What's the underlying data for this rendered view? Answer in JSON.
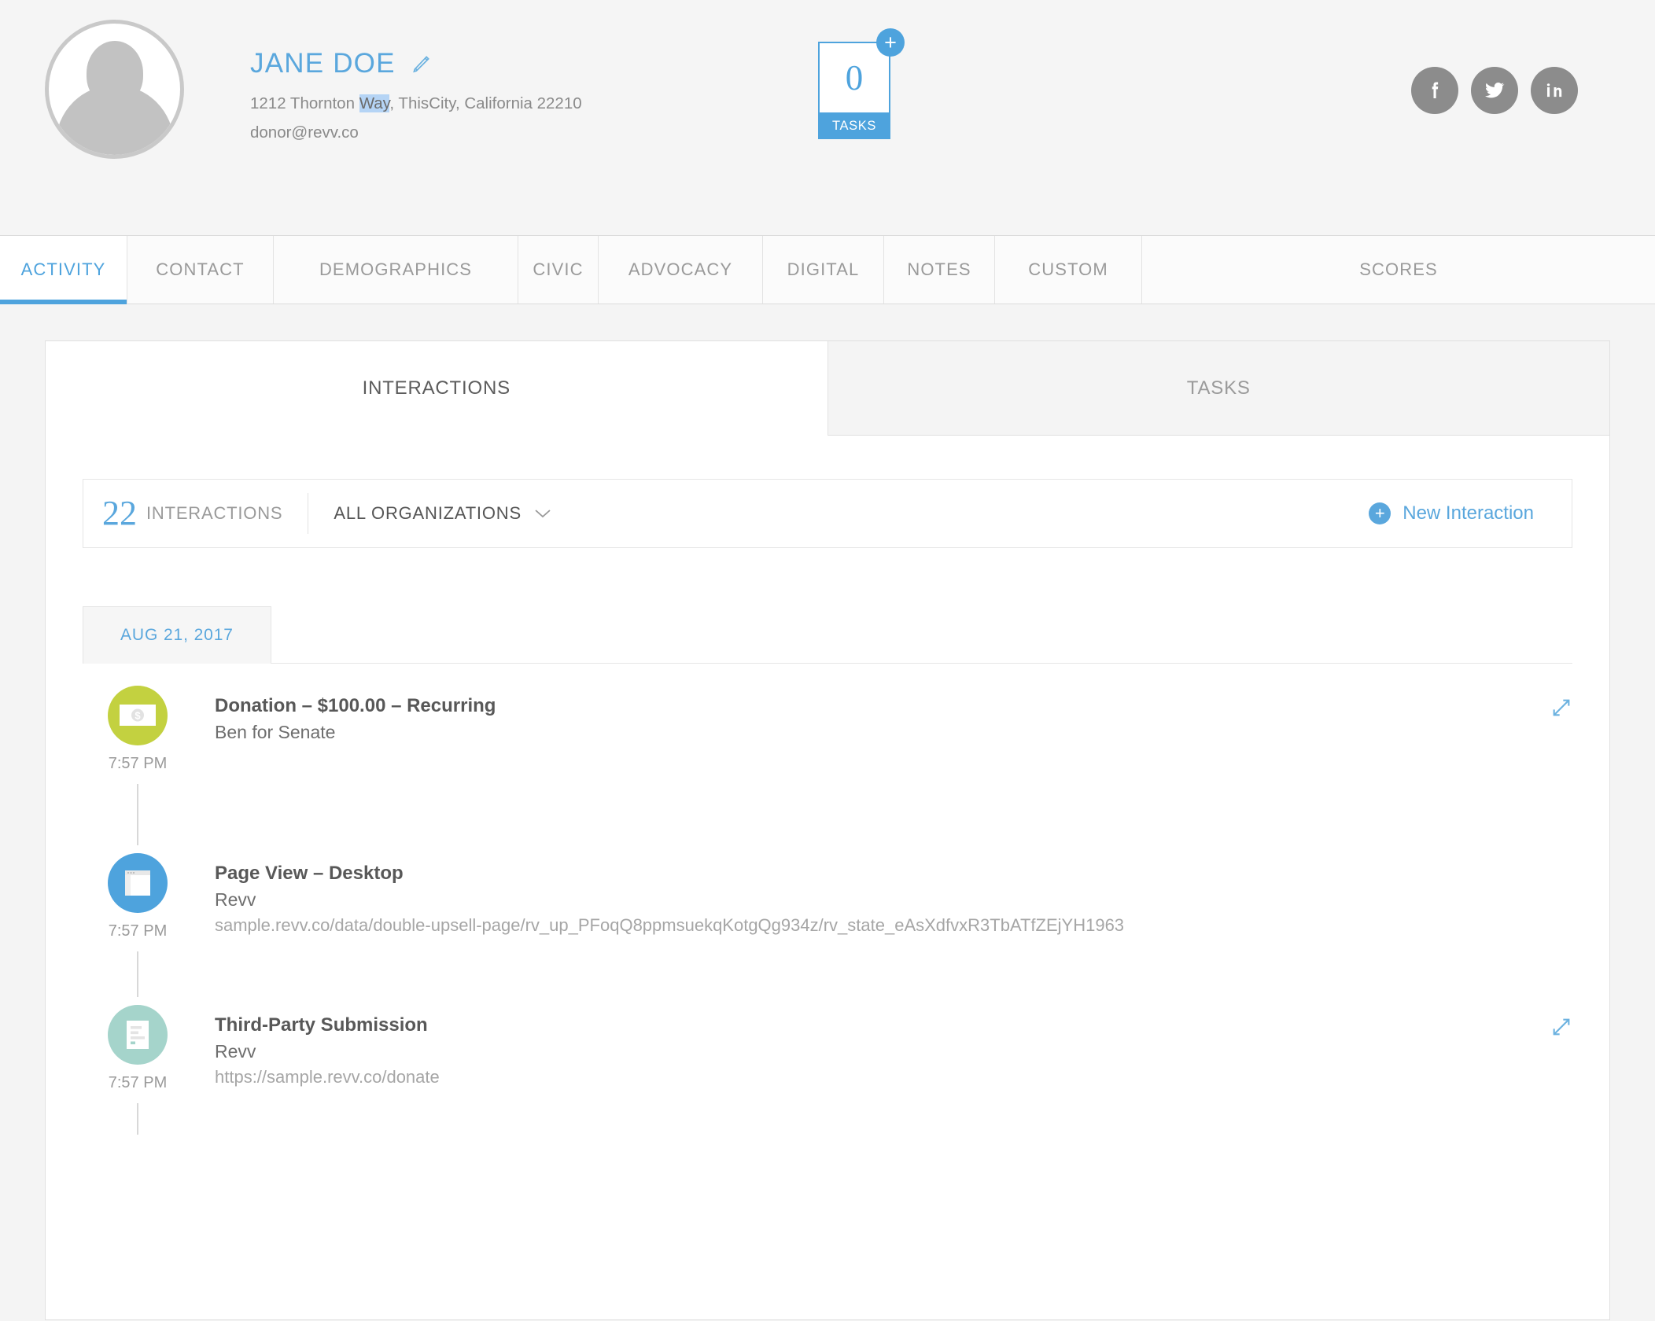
{
  "profile": {
    "name": "JANE DOE",
    "address_pre": "1212 Thornton ",
    "address_selected": "Way",
    "address_post": ", ThisCity, California 22210",
    "email": "donor@revv.co",
    "edit_icon": "pencil-icon",
    "avatar_icon": "default-avatar-icon"
  },
  "tasks": {
    "count": "0",
    "label": "TASKS",
    "add": "+"
  },
  "socials": [
    {
      "name": "facebook",
      "glyph": "f"
    },
    {
      "name": "twitter",
      "glyph": "t"
    },
    {
      "name": "linkedin",
      "glyph": "in"
    }
  ],
  "main_tabs": [
    {
      "label": "ACTIVITY",
      "active": true
    },
    {
      "label": "CONTACT",
      "active": false
    },
    {
      "label": "DEMOGRAPHICS",
      "active": false
    },
    {
      "label": "CIVIC",
      "active": false
    },
    {
      "label": "ADVOCACY",
      "active": false
    },
    {
      "label": "DIGITAL",
      "active": false
    },
    {
      "label": "NOTES",
      "active": false
    },
    {
      "label": "CUSTOM",
      "active": false
    },
    {
      "label": "SCORES",
      "active": false
    }
  ],
  "sub_tabs": [
    {
      "label": "INTERACTIONS",
      "active": true
    },
    {
      "label": "TASKS",
      "active": false
    }
  ],
  "filter": {
    "count": "22",
    "count_label": "INTERACTIONS",
    "organization": "ALL ORGANIZATIONS",
    "new_interaction": "New Interaction",
    "plus": "+"
  },
  "timeline": {
    "date": "AUG 21, 2017",
    "items": [
      {
        "time": "7:57 PM",
        "title": "Donation – $100.00 – Recurring",
        "org": "Ben for Senate",
        "url": "",
        "icon": "money-bill-icon",
        "icon_color": "#c3d140"
      },
      {
        "time": "7:57 PM",
        "title": "Page View – Desktop",
        "org": "Revv",
        "url": "sample.revv.co/data/double-upsell-page/rv_up_PFoqQ8ppmsuekqKotgQg934z/rv_state_eAsXdfvxR3TbATfZEjYH1963",
        "icon": "browser-window-icon",
        "icon_color": "#4ea3dd"
      },
      {
        "time": "7:57 PM",
        "title": "Third-Party Submission",
        "org": "Revv",
        "url": "https://sample.revv.co/donate",
        "icon": "form-document-icon",
        "icon_color": "#a5d4cb"
      }
    ]
  },
  "colors": {
    "accent_blue": "#4ea3dd",
    "link_blue": "#5aa7dd",
    "page_bg": "#f4f4f4",
    "text_gray": "#8a8a8a"
  }
}
